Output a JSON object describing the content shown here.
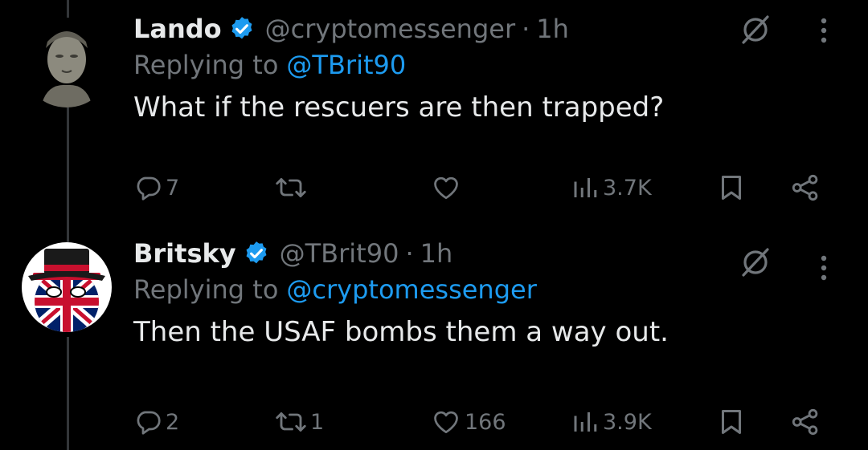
{
  "tweets": [
    {
      "name": "Lando",
      "handle": "@cryptomessenger",
      "separator": "·",
      "time": "1h",
      "replying_prefix": "Replying to",
      "replying_to": "@TBrit90",
      "text": "What if the rescuers are then trapped?",
      "replies": "7",
      "retweets": "",
      "likes": "",
      "views": "3.7K",
      "avatar_icon": "terracotta-warrior-avatar"
    },
    {
      "name": "Britsky",
      "handle": "@TBrit90",
      "separator": "·",
      "time": "1h",
      "replying_prefix": "Replying to",
      "replying_to": "@cryptomessenger",
      "text": "Then the USAF bombs them a way out.",
      "replies": "2",
      "retweets": "1",
      "likes": "166",
      "views": "3.9K",
      "avatar_icon": "union-jack-countryball-avatar"
    }
  ],
  "colors": {
    "background": "#000000",
    "text_primary": "#e7e9ea",
    "text_secondary": "#71767b",
    "accent": "#1d9bf0",
    "thread_line": "#333639"
  }
}
